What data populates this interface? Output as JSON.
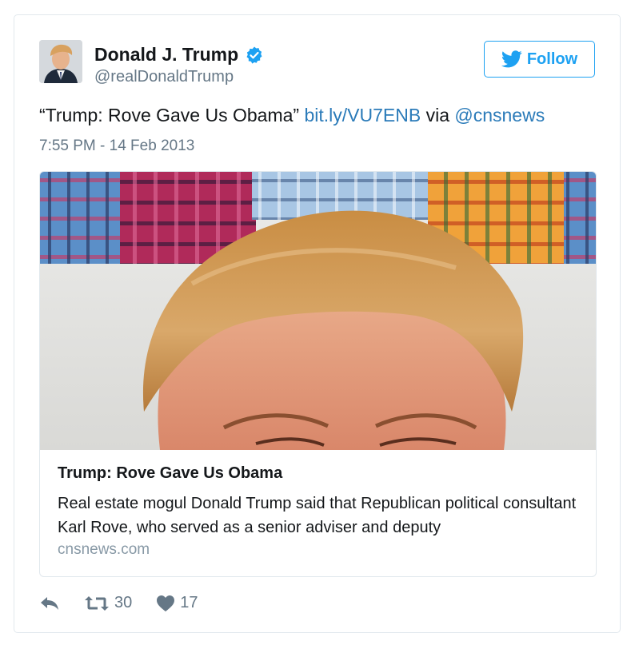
{
  "author": {
    "name": "Donald J. Trump",
    "handle": "@realDonaldTrump"
  },
  "follow_label": "Follow",
  "tweet": {
    "text_quote": "“Trump: Rove Gave Us Obama”",
    "link": "bit.ly/VU7ENB",
    "via": "via",
    "mention": "@cnsnews",
    "timestamp": "7:55 PM - 14 Feb 2013"
  },
  "card": {
    "title": "Trump: Rove Gave Us Obama",
    "description": "Real estate mogul Donald Trump said that Republican political consultant Karl Rove, who served as a senior adviser and deputy",
    "domain": "cnsnews.com"
  },
  "actions": {
    "retweets": "30",
    "likes": "17"
  },
  "colors": {
    "accent": "#1da1f2",
    "link": "#2b7bb9",
    "muted": "#657786",
    "like_icon": "#657786"
  },
  "icons": [
    "verified-badge-icon",
    "twitter-bird-icon",
    "reply-icon",
    "retweet-icon",
    "heart-icon"
  ]
}
